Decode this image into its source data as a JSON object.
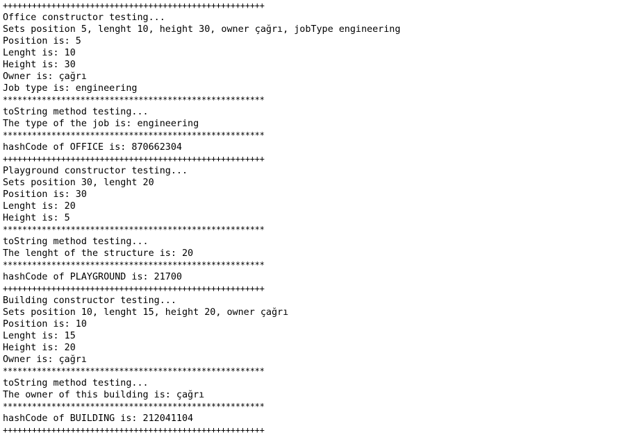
{
  "console": {
    "lines": [
      "++++++++++++++++++++++++++++++++++++++++++++++++++++++",
      "Office constructor testing...",
      "Sets position 5, lenght 10, height 30, owner çağrı, jobType engineering",
      "Position is: 5",
      "Lenght is: 10",
      "Height is: 30",
      "Owner is: çağrı",
      "Job type is: engineering",
      "******************************************************",
      "toString method testing...",
      "The type of the job is: engineering",
      "******************************************************",
      "hashCode of OFFICE is: 870662304",
      "++++++++++++++++++++++++++++++++++++++++++++++++++++++",
      "Playground constructor testing...",
      "Sets position 30, lenght 20",
      "Position is: 30",
      "Lenght is: 20",
      "Height is: 5",
      "******************************************************",
      "toString method testing...",
      "The lenght of the structure is: 20",
      "******************************************************",
      "hashCode of PLAYGROUND is: 21700",
      "++++++++++++++++++++++++++++++++++++++++++++++++++++++",
      "Building constructor testing...",
      "Sets position 10, lenght 15, height 20, owner çağrı",
      "Position is: 10",
      "Lenght is: 15",
      "Height is: 20",
      "Owner is: çağrı",
      "******************************************************",
      "toString method testing...",
      "The owner of this building is: çağrı",
      "******************************************************",
      "hashCode of BUILDING is: 212041104",
      "++++++++++++++++++++++++++++++++++++++++++++++++++++++"
    ]
  }
}
